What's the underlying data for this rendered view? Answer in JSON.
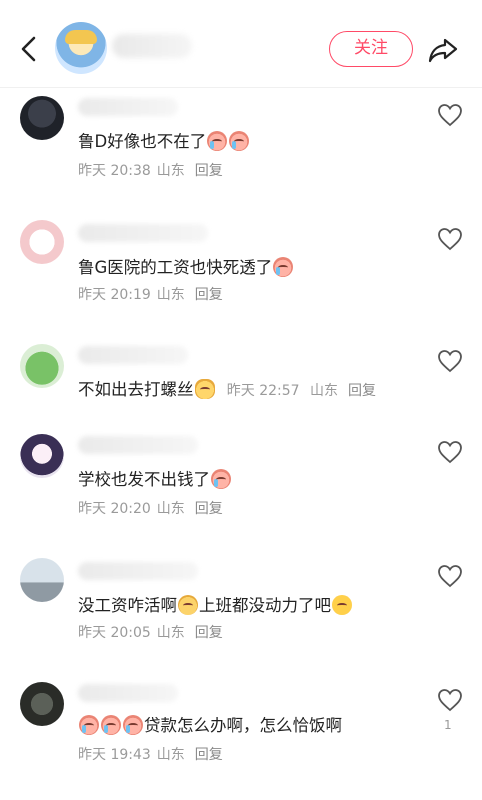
{
  "header": {
    "follow_label": "关注"
  },
  "comments": [
    {
      "text_pre": "鲁D好像也不在了",
      "emojis": [
        "cry",
        "cry"
      ],
      "text_post": "",
      "time": "昨天 20:38",
      "location": "山东",
      "reply": "回复"
    },
    {
      "text_pre": "鲁G医院的工资也快死透了",
      "emojis": [
        "cry"
      ],
      "text_post": "",
      "time": "昨天 20:19",
      "location": "山东",
      "reply": "回复"
    },
    {
      "text_pre": "不如出去打螺丝",
      "emojis": [
        "cat"
      ],
      "text_post": "",
      "time": "昨天 22:57",
      "location": "山东",
      "reply": "回复"
    },
    {
      "text_pre": "学校也发不出钱了",
      "emojis": [
        "cry"
      ],
      "text_post": "",
      "time": "昨天 20:20",
      "location": "山东",
      "reply": "回复"
    },
    {
      "text_pre": "没工资咋活啊",
      "emojis": [
        "sweat"
      ],
      "text_post": "上班都没动力了吧",
      "emojis_after": [
        "tired"
      ],
      "time": "昨天 20:05",
      "location": "山东",
      "reply": "回复"
    },
    {
      "text_pre": "",
      "emojis": [
        "cry",
        "cry",
        "cry"
      ],
      "text_post": "贷款怎么办啊，怎么恰饭啊",
      "time": "昨天 19:43",
      "location": "山东",
      "reply": "回复",
      "likes": "1"
    }
  ],
  "icons": {
    "back": "back-arrow-icon",
    "share": "share-icon",
    "like": "heart-icon"
  },
  "colors": {
    "accent": "#ff4a67",
    "meta": "#9a9a9a"
  }
}
